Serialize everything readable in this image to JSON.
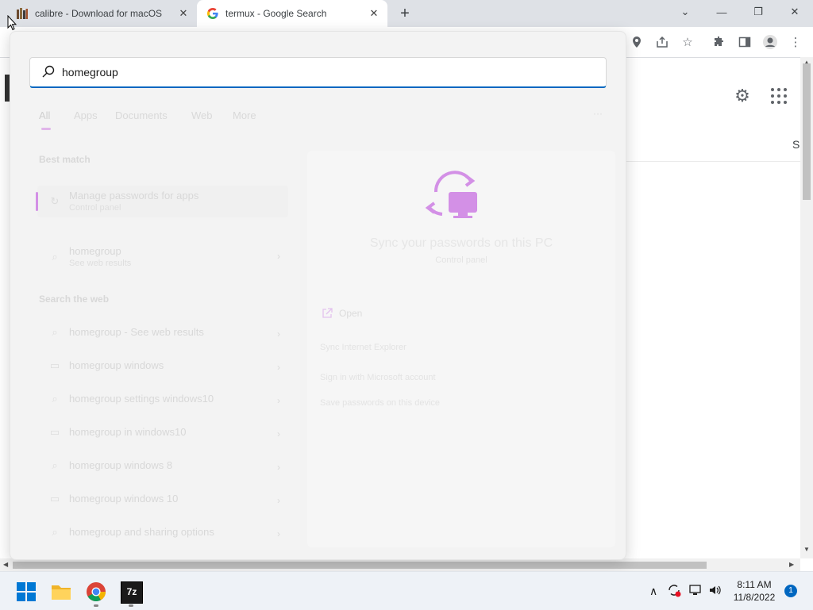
{
  "browser": {
    "tabs": [
      {
        "title": "calibre - Download for macOS",
        "favicon": "book-stack-icon"
      },
      {
        "title": "termux - Google Search",
        "favicon": "google-g-icon"
      }
    ],
    "new_tab_glyph": "+"
  },
  "search": {
    "query": "homegroup",
    "filter_tabs": [
      "All",
      "Apps",
      "Documents",
      "Web",
      "More"
    ],
    "sections": {
      "best_match": "Best match",
      "search_web": "Search the web"
    },
    "best_match": [
      {
        "title": "Manage passwords for apps",
        "subtitle": "Control panel",
        "selected": true
      },
      {
        "title": "homegroup",
        "subtitle": "See web results",
        "selected": false
      }
    ],
    "web_results": [
      {
        "text": "homegroup - See web results",
        "icon": "search-icon"
      },
      {
        "text": "homegroup windows",
        "icon": "page-icon"
      },
      {
        "text": "homegroup settings windows10",
        "icon": "search-icon"
      },
      {
        "text": "homegroup in windows10",
        "icon": "page-icon"
      },
      {
        "text": "homegroup windows 8",
        "icon": "search-icon"
      },
      {
        "text": "homegroup windows 10",
        "icon": "page-icon"
      },
      {
        "text": "homegroup and sharing options",
        "icon": "search-icon"
      }
    ],
    "preview": {
      "title": "Sync your passwords on this PC",
      "subtitle": "Control panel",
      "open_label": "Open",
      "links": [
        "Sync Internet Explorer",
        "Sign in with Microsoft account",
        "Save passwords on this device"
      ],
      "accent": "#d390e6"
    }
  },
  "page": {
    "partial_letter": "S"
  },
  "taskbar": {
    "apps": [
      "windows-start-icon",
      "file-explorer-icon",
      "chrome-icon",
      "7zip-icon"
    ],
    "app_7z_label": "7z",
    "time": "8:11 AM",
    "date": "11/8/2022",
    "notification_count": "1"
  },
  "colors": {
    "accent_blue": "#0067c0",
    "flyout_bg": "#f3f3f3",
    "tabstrip_bg": "#dee1e6",
    "taskbar_bg": "#eef2f7"
  }
}
